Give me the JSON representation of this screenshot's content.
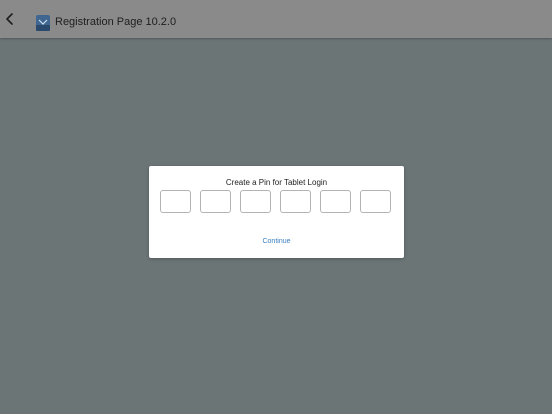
{
  "header": {
    "title": "Registration Page 10.2.0",
    "back_icon": "chevron-left-icon",
    "app_icon": "app-logo-icon"
  },
  "dialog": {
    "title": "Create a Pin for Tablet Login",
    "pin_length": 6,
    "pin_values": [
      "",
      "",
      "",
      "",
      "",
      ""
    ],
    "continue_label": "Continue"
  },
  "colors": {
    "backdrop": "#6b7576",
    "header_bg": "#8a8a8a",
    "accent": "#3a7fc0"
  }
}
